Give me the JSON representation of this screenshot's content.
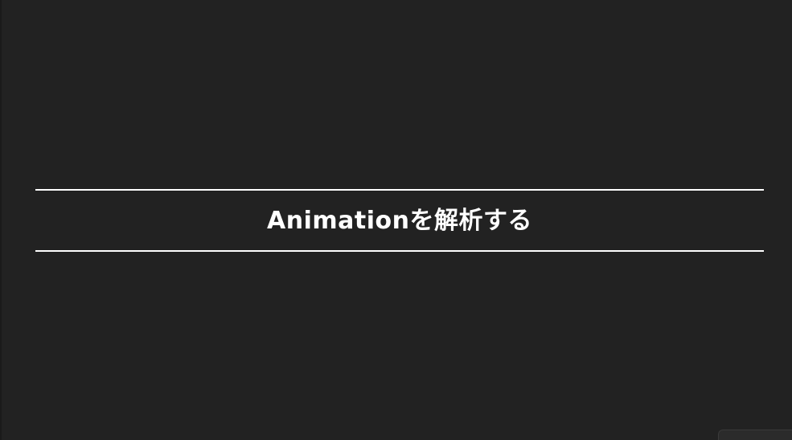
{
  "slide": {
    "title": "Animationを解析する"
  },
  "colors": {
    "background": "#222222",
    "text": "#ffffff",
    "rule": "#ffffff"
  }
}
